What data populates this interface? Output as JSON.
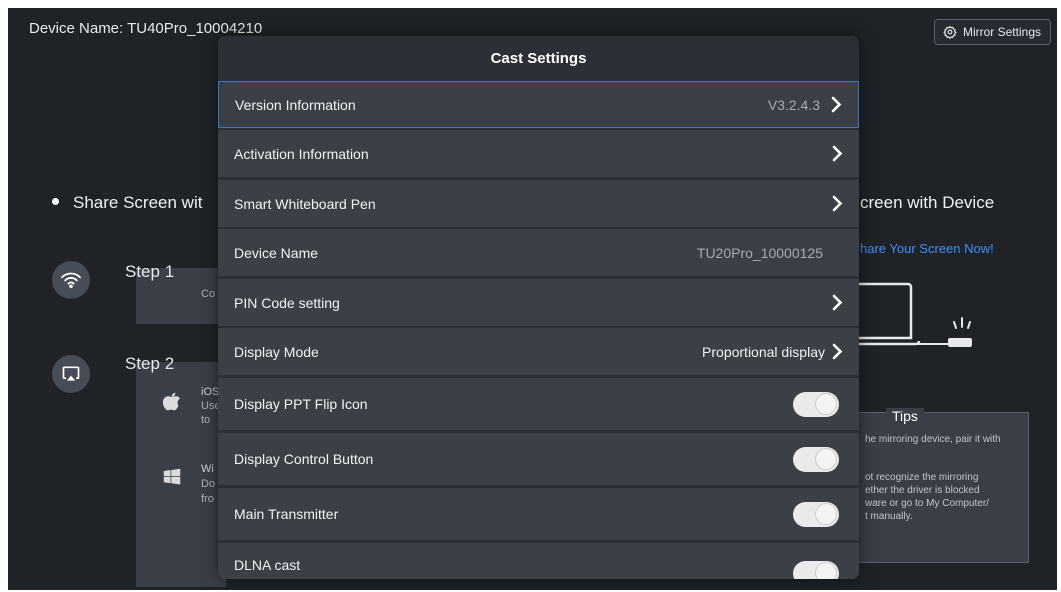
{
  "header": {
    "device_name": "Device Name: TU40Pro_10004210",
    "mirror_settings_label": "Mirror Settings",
    "mirror_settings_icon": "gear-icon"
  },
  "left_panel": {
    "share_title": "Share Screen wit",
    "step1_label": "Step  1",
    "step1_text": "Co",
    "step2_label": "Step  2",
    "ios_lines": [
      "iOS",
      "Use",
      "to"
    ],
    "win_lines": [
      "Wi",
      "Do",
      "fro"
    ]
  },
  "right_panel": {
    "share_title": "creen with Device",
    "share_now": "hare Your Screen Now!",
    "tips_title": "Tips",
    "tips_lines": [
      "he mirroring device, pair it with",
      "ot recognize the mirroring",
      "ether the driver is blocked",
      "ware or go to My Computer/",
      "t manually."
    ]
  },
  "dialog": {
    "title": "Cast Settings",
    "rows": [
      {
        "label": "Version Information",
        "value": "V3.2.4.3",
        "control": "chevron",
        "selected": true
      },
      {
        "label": "Activation Information",
        "value": "",
        "control": "chevron"
      },
      {
        "label": "Smart Whiteboard Pen",
        "value": "",
        "control": "chevron"
      },
      {
        "label": "Device Name",
        "value": "TU20Pro_10000125",
        "control": "none"
      },
      {
        "label": "PIN Code setting",
        "value": "",
        "control": "chevron"
      },
      {
        "label": "Display Mode",
        "value": "Proportional display",
        "control": "chevron"
      },
      {
        "label": "Display PPT Flip Icon",
        "value": "",
        "control": "toggle",
        "state": "off"
      },
      {
        "label": "Display Control Button",
        "value": "",
        "control": "toggle",
        "state": "off"
      },
      {
        "label": "Main Transmitter",
        "value": "",
        "control": "toggle",
        "state": "off"
      },
      {
        "label": "DLNA cast",
        "value": "",
        "control": "toggle",
        "state": "off"
      }
    ]
  },
  "colors": {
    "background": "#1f2328",
    "dialog": "#2c3036",
    "row": "#3b3f46",
    "selection_border": "#3a78c7",
    "link": "#3f8ff5"
  }
}
